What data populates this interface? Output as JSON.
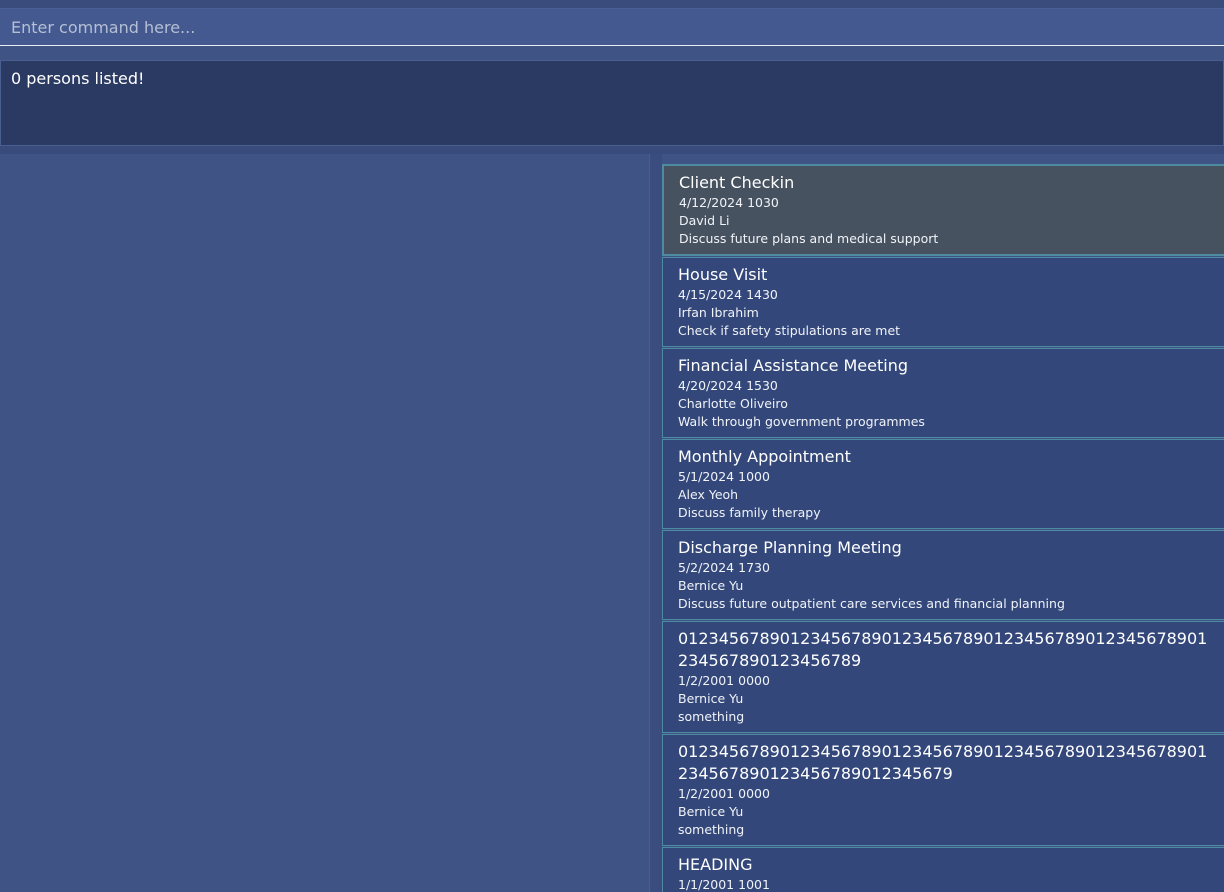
{
  "command": {
    "placeholder": "Enter command here...",
    "value": ""
  },
  "result": {
    "message": "0 persons listed!"
  },
  "appointments": [
    {
      "title": "Client Checkin",
      "datetime": "4/12/2024 1030",
      "person": "David Li",
      "note": "Discuss future plans and medical support",
      "selected": true
    },
    {
      "title": "House Visit",
      "datetime": "4/15/2024 1430",
      "person": "Irfan Ibrahim",
      "note": "Check if safety stipulations are met",
      "selected": false
    },
    {
      "title": "Financial Assistance Meeting",
      "datetime": "4/20/2024 1530",
      "person": "Charlotte Oliveiro",
      "note": "Walk through government programmes",
      "selected": false
    },
    {
      "title": "Monthly Appointment",
      "datetime": "5/1/2024 1000",
      "person": "Alex Yeoh",
      "note": "Discuss family therapy",
      "selected": false
    },
    {
      "title": "Discharge Planning Meeting",
      "datetime": "5/2/2024 1730",
      "person": "Bernice Yu",
      "note": "Discuss future outpatient care services and financial planning",
      "selected": false
    },
    {
      "title": "0123456789012345678901234567890123456789012345678901234567890123456789",
      "datetime": "1/2/2001 0000",
      "person": "Bernice Yu",
      "note": "something",
      "selected": false
    },
    {
      "title": "0123456789012345678901234567890123456789012345678901234567890123456789012345679",
      "datetime": "1/2/2001 0000",
      "person": "Bernice Yu",
      "note": "something",
      "selected": false
    },
    {
      "title": "HEADING",
      "datetime": "1/1/2001 1001",
      "person": "",
      "note": "",
      "selected": false
    }
  ]
}
